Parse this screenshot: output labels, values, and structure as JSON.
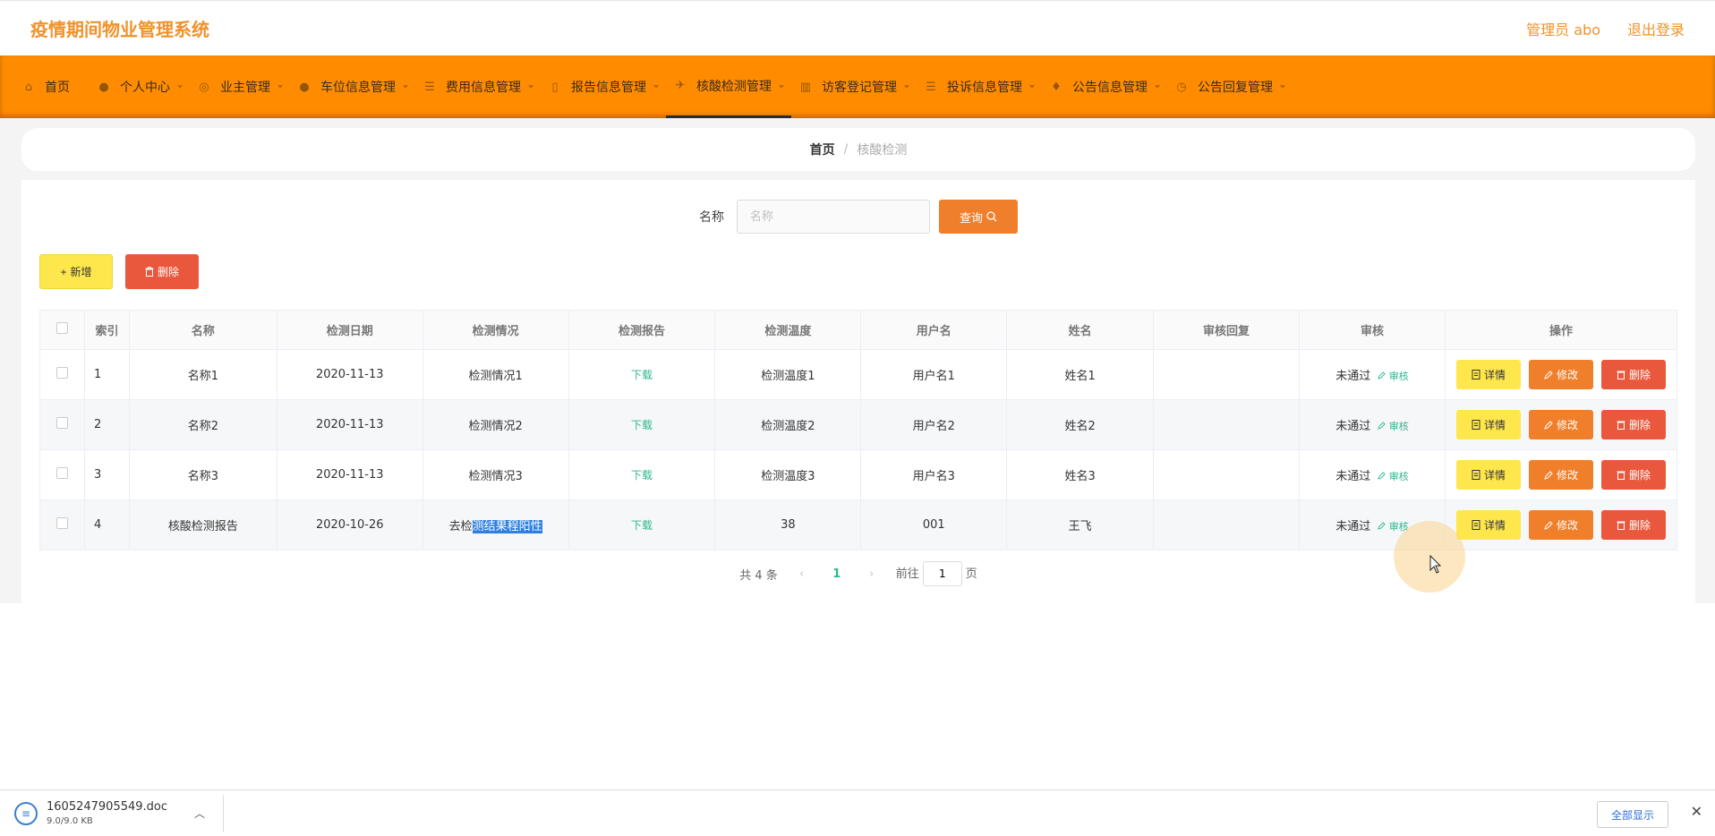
{
  "header": {
    "app_title": "疫情期间物业管理系统",
    "user_label": "管理员 abo",
    "logout": "退出登录"
  },
  "nav": [
    {
      "label": "首页",
      "icon": "home-icon",
      "glyph": "⌂",
      "caret": false
    },
    {
      "label": "个人中心",
      "icon": "user-icon",
      "glyph": "●",
      "caret": true
    },
    {
      "label": "业主管理",
      "icon": "owner-icon",
      "glyph": "◎",
      "caret": true
    },
    {
      "label": "车位信息管理",
      "icon": "parking-icon",
      "glyph": "●",
      "caret": true
    },
    {
      "label": "费用信息管理",
      "icon": "fee-icon",
      "glyph": "☰",
      "caret": true
    },
    {
      "label": "报告信息管理",
      "icon": "report-icon",
      "glyph": "▯",
      "caret": true
    },
    {
      "label": "核酸检测管理",
      "icon": "test-icon",
      "glyph": "✈",
      "caret": true,
      "active": true
    },
    {
      "label": "访客登记管理",
      "icon": "visitor-icon",
      "glyph": "▥",
      "caret": true
    },
    {
      "label": "投诉信息管理",
      "icon": "complaint-icon",
      "glyph": "☰",
      "caret": true
    },
    {
      "label": "公告信息管理",
      "icon": "notice-icon",
      "glyph": "♦",
      "caret": true
    },
    {
      "label": "公告回复管理",
      "icon": "reply-icon",
      "glyph": "◷",
      "caret": true
    }
  ],
  "breadcrumb": {
    "home": "首页",
    "sep": "/",
    "current": "核酸检测"
  },
  "search": {
    "label": "名称",
    "placeholder": "名称",
    "value": "",
    "button": "查询"
  },
  "actions": {
    "add": "新增",
    "delete": "删除"
  },
  "table": {
    "columns": [
      "索引",
      "名称",
      "检测日期",
      "检测情况",
      "检测报告",
      "检测温度",
      "用户名",
      "姓名",
      "审核回复",
      "审核",
      "操作"
    ],
    "rows": [
      {
        "index": "1",
        "name": "名称1",
        "date": "2020-11-13",
        "status_pre": "检测情况1",
        "status_sel": "",
        "report": "下载",
        "temp": "检测温度1",
        "username": "用户名1",
        "realname": "姓名1",
        "reply": "",
        "audit": "未通过",
        "audit_link": "审核"
      },
      {
        "index": "2",
        "name": "名称2",
        "date": "2020-11-13",
        "status_pre": "检测情况2",
        "status_sel": "",
        "report": "下载",
        "temp": "检测温度2",
        "username": "用户名2",
        "realname": "姓名2",
        "reply": "",
        "audit": "未通过",
        "audit_link": "审核"
      },
      {
        "index": "3",
        "name": "名称3",
        "date": "2020-11-13",
        "status_pre": "检测情况3",
        "status_sel": "",
        "report": "下载",
        "temp": "检测温度3",
        "username": "用户名3",
        "realname": "姓名3",
        "reply": "",
        "audit": "未通过",
        "audit_link": "审核"
      },
      {
        "index": "4",
        "name": "核酸检测报告",
        "date": "2020-10-26",
        "status_pre": "去检",
        "status_sel": "测结果程阳性",
        "report": "下载",
        "temp": "38",
        "username": "001",
        "realname": "王飞",
        "reply": "",
        "audit": "未通过",
        "audit_link": "审核"
      }
    ],
    "row_actions": {
      "detail": "详情",
      "edit": "修改",
      "delete": "删除"
    }
  },
  "pager": {
    "total": "共 4 条",
    "page": "1",
    "goto_label": "前往",
    "goto_value": "1",
    "page_suffix": "页"
  },
  "download_bar": {
    "filename": "1605247905549.doc",
    "size": "9.0/9.0 KB",
    "show_all": "全部显示"
  }
}
